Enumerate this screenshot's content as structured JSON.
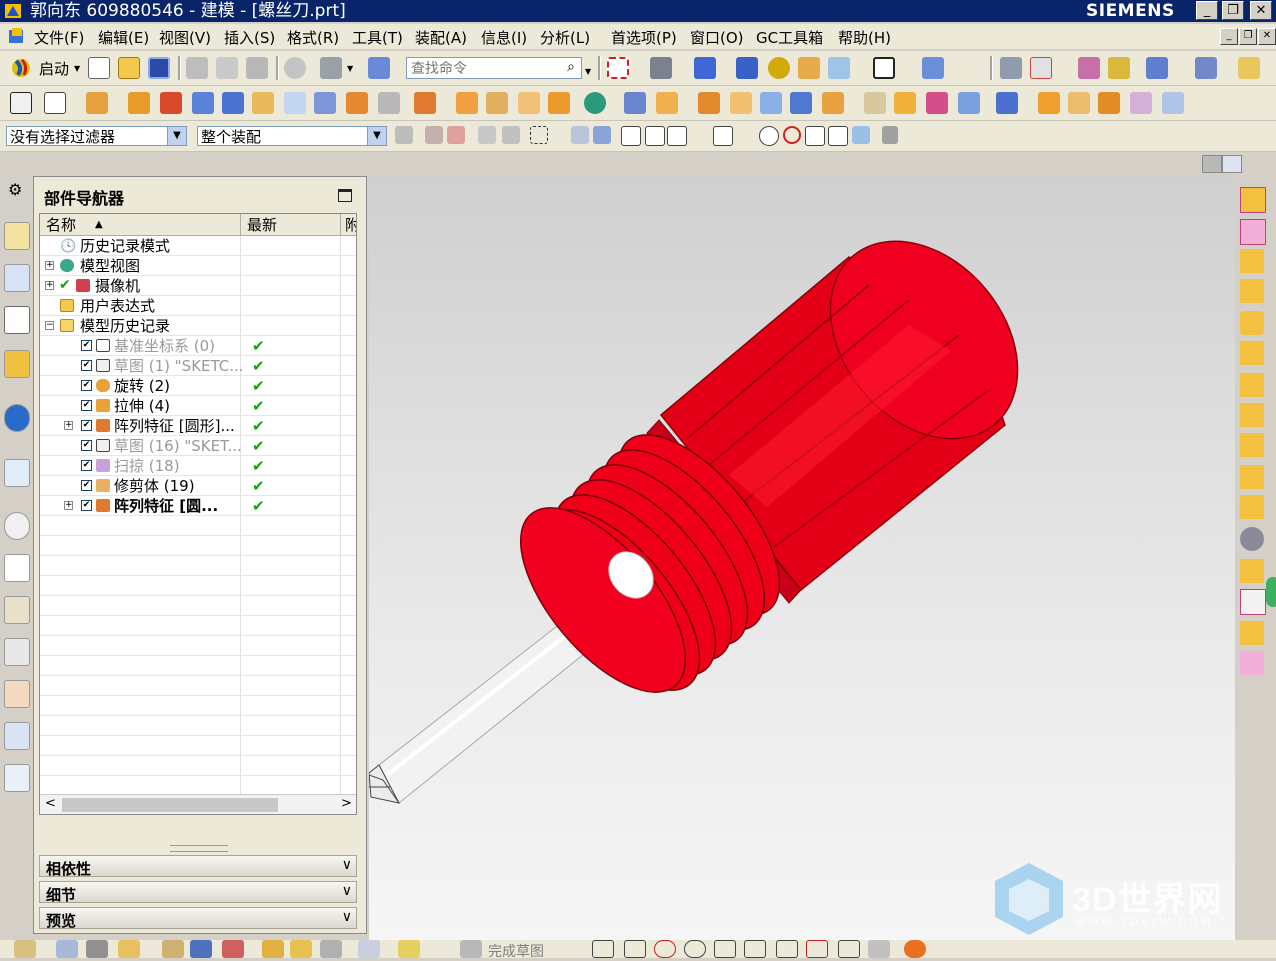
{
  "window": {
    "title": "郭向东 609880546 - 建模 - [螺丝刀.prt]",
    "brand": "SIEMENS",
    "controls": [
      "_",
      "❐",
      "✕"
    ]
  },
  "menu": {
    "items": [
      "文件(F)",
      "编辑(E)",
      "视图(V)",
      "插入(S)",
      "格式(R)",
      "工具(T)",
      "装配(A)",
      "信息(I)",
      "分析(L)",
      "首选项(P)",
      "窗口(O)",
      "GC工具箱",
      "帮助(H)"
    ]
  },
  "toolbar": {
    "start_label": "启动",
    "search_placeholder": "查找命令"
  },
  "filter": {
    "selection_filter": "没有选择过滤器",
    "assembly_scope": "整个装配"
  },
  "navigator": {
    "title": "部件导航器",
    "columns": {
      "name": "名称",
      "latest": "最新",
      "extra": "附"
    },
    "rows": [
      {
        "label": "历史记录模式",
        "state": "normal",
        "checked": false,
        "latest": ""
      },
      {
        "label": "模型视图",
        "state": "normal",
        "checked": false,
        "latest": ""
      },
      {
        "label": "摄像机",
        "state": "normal",
        "checked": false,
        "latest": ""
      },
      {
        "label": "用户表达式",
        "state": "normal",
        "checked": false,
        "latest": ""
      },
      {
        "label": "模型历史记录",
        "state": "normal",
        "checked": false,
        "latest": ""
      },
      {
        "label": "基准坐标系 (0)",
        "state": "grey",
        "checked": true,
        "latest": "✔"
      },
      {
        "label": "草图 (1) \"SKETC...",
        "state": "grey",
        "checked": true,
        "latest": "✔"
      },
      {
        "label": "旋转 (2)",
        "state": "normal",
        "checked": true,
        "latest": "✔"
      },
      {
        "label": "拉伸 (4)",
        "state": "normal",
        "checked": true,
        "latest": "✔"
      },
      {
        "label": "阵列特征 [圆形]...",
        "state": "normal",
        "checked": true,
        "latest": "✔"
      },
      {
        "label": "草图 (16) \"SKET...",
        "state": "grey",
        "checked": true,
        "latest": "✔"
      },
      {
        "label": "扫掠 (18)",
        "state": "grey",
        "checked": true,
        "latest": "✔"
      },
      {
        "label": "修剪体 (19)",
        "state": "normal",
        "checked": true,
        "latest": "✔"
      },
      {
        "label": "阵列特征 [圆...",
        "state": "bold",
        "checked": true,
        "latest": "✔"
      }
    ],
    "sections": [
      "相依性",
      "细节",
      "预览"
    ]
  },
  "statusbar": {
    "finish_sketch": "完成草图"
  },
  "watermark": {
    "main": "3D世界网",
    "sub": "WWW.3DSJW.COM"
  },
  "colors": {
    "model_red": "#e8001a",
    "title_bar": "#0a246a",
    "check_green": "#12a012"
  }
}
